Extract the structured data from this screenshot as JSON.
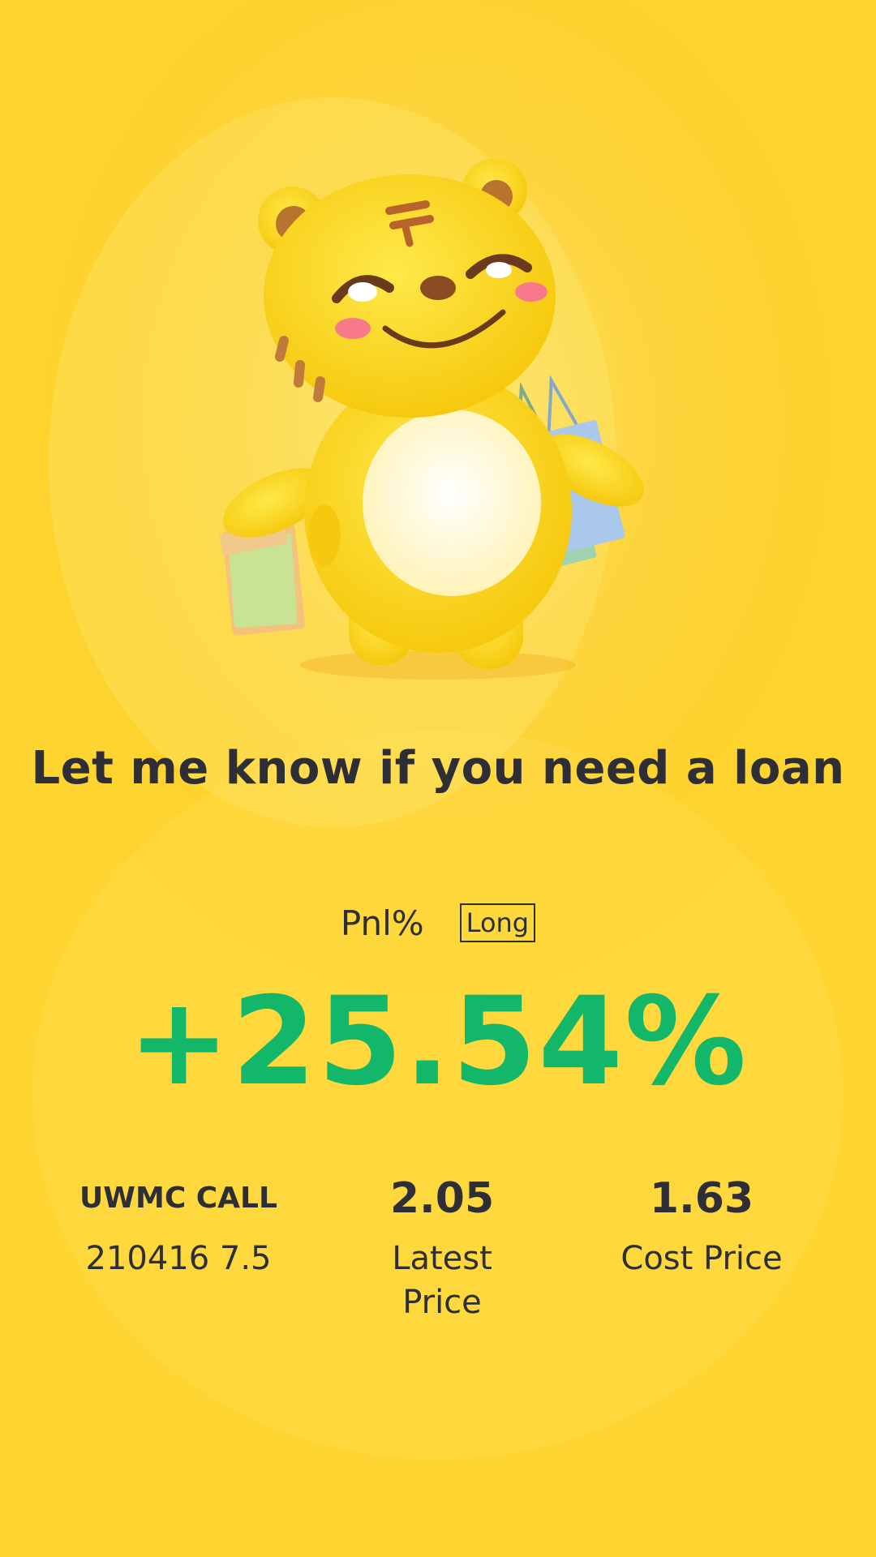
{
  "headline": "Let me know if you need a loan",
  "pnl": {
    "label": "Pnl%",
    "direction": "Long",
    "value": "+25.54%",
    "value_color": "#12b76a"
  },
  "stats": [
    {
      "top": "UWMC CALL",
      "bottom": "210416 7.5"
    },
    {
      "top": "2.05",
      "bottom": "Latest Price"
    },
    {
      "top": "1.63",
      "bottom": "Cost Price"
    }
  ],
  "mascot": {
    "icon": "tiger-mascot-with-shopping-bags-icon"
  },
  "colors": {
    "background": "#fed32e",
    "text": "#2e2f36",
    "positive": "#12b76a"
  }
}
